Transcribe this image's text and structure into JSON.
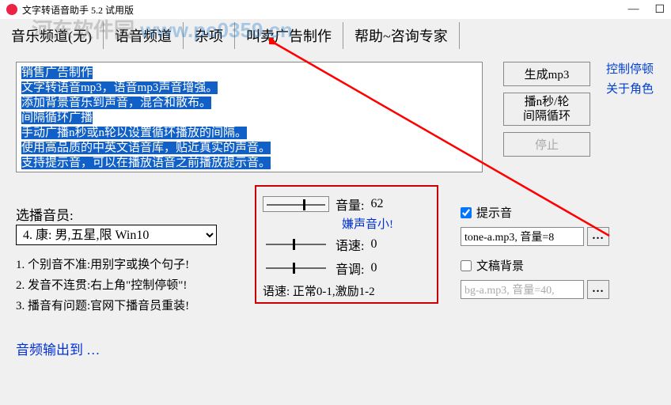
{
  "title": "文字转语音助手 5.2 试用版",
  "watermark": {
    "a": "河东软件园",
    "b": "www.pc0359.cn"
  },
  "tabs": [
    "音乐频道(无)",
    "语音频道",
    "杂项",
    "叫卖广告制作",
    "帮助~咨询专家"
  ],
  "textarea_lines": [
    "销售广告制作",
    "文字转语音mp3，语音mp3声音增强。",
    "添加背景音乐到声音，混合和散布。",
    "间隔循环广播",
    "手动广播n秒或n轮以设置循环播放的间隔。",
    "使用高品质的中英文语音库，贴近真实的声音。",
    "支持提示音，可以在播放语音之前播放提示音。"
  ],
  "buttons": {
    "gen": "生成mp3",
    "loop": "播n秒/轮\n间隔循环",
    "stop": "停止"
  },
  "links": {
    "ctrl": "控制停顿",
    "role": "关于角色"
  },
  "voice": {
    "label": "选播音员:",
    "selected": "4. 康: 男,五星,限 Win10"
  },
  "tips": [
    "1. 个别音不准:用别字或换个句子!",
    "2. 发音不连贯:右上角\"控制停顿\"!",
    "3. 播音有问题:官网下播音员重装!"
  ],
  "sliders": {
    "vol": {
      "label": "音量:",
      "val": "62"
    },
    "lowvol": "嫌声音小!",
    "speed": {
      "label": "语速:",
      "val": "0"
    },
    "pitch": {
      "label": "音调:",
      "val": "0"
    },
    "speedtxt": "语速: 正常0-1,激励1-2"
  },
  "right2": {
    "tone_chk": "提示音",
    "tone_val": "tone-a.mp3, 音量=8",
    "bg_chk": "文稿背景",
    "bg_val": "bg-a.mp3, 音量=40,"
  },
  "audio_out": "音频输出到 …",
  "dots": "…"
}
